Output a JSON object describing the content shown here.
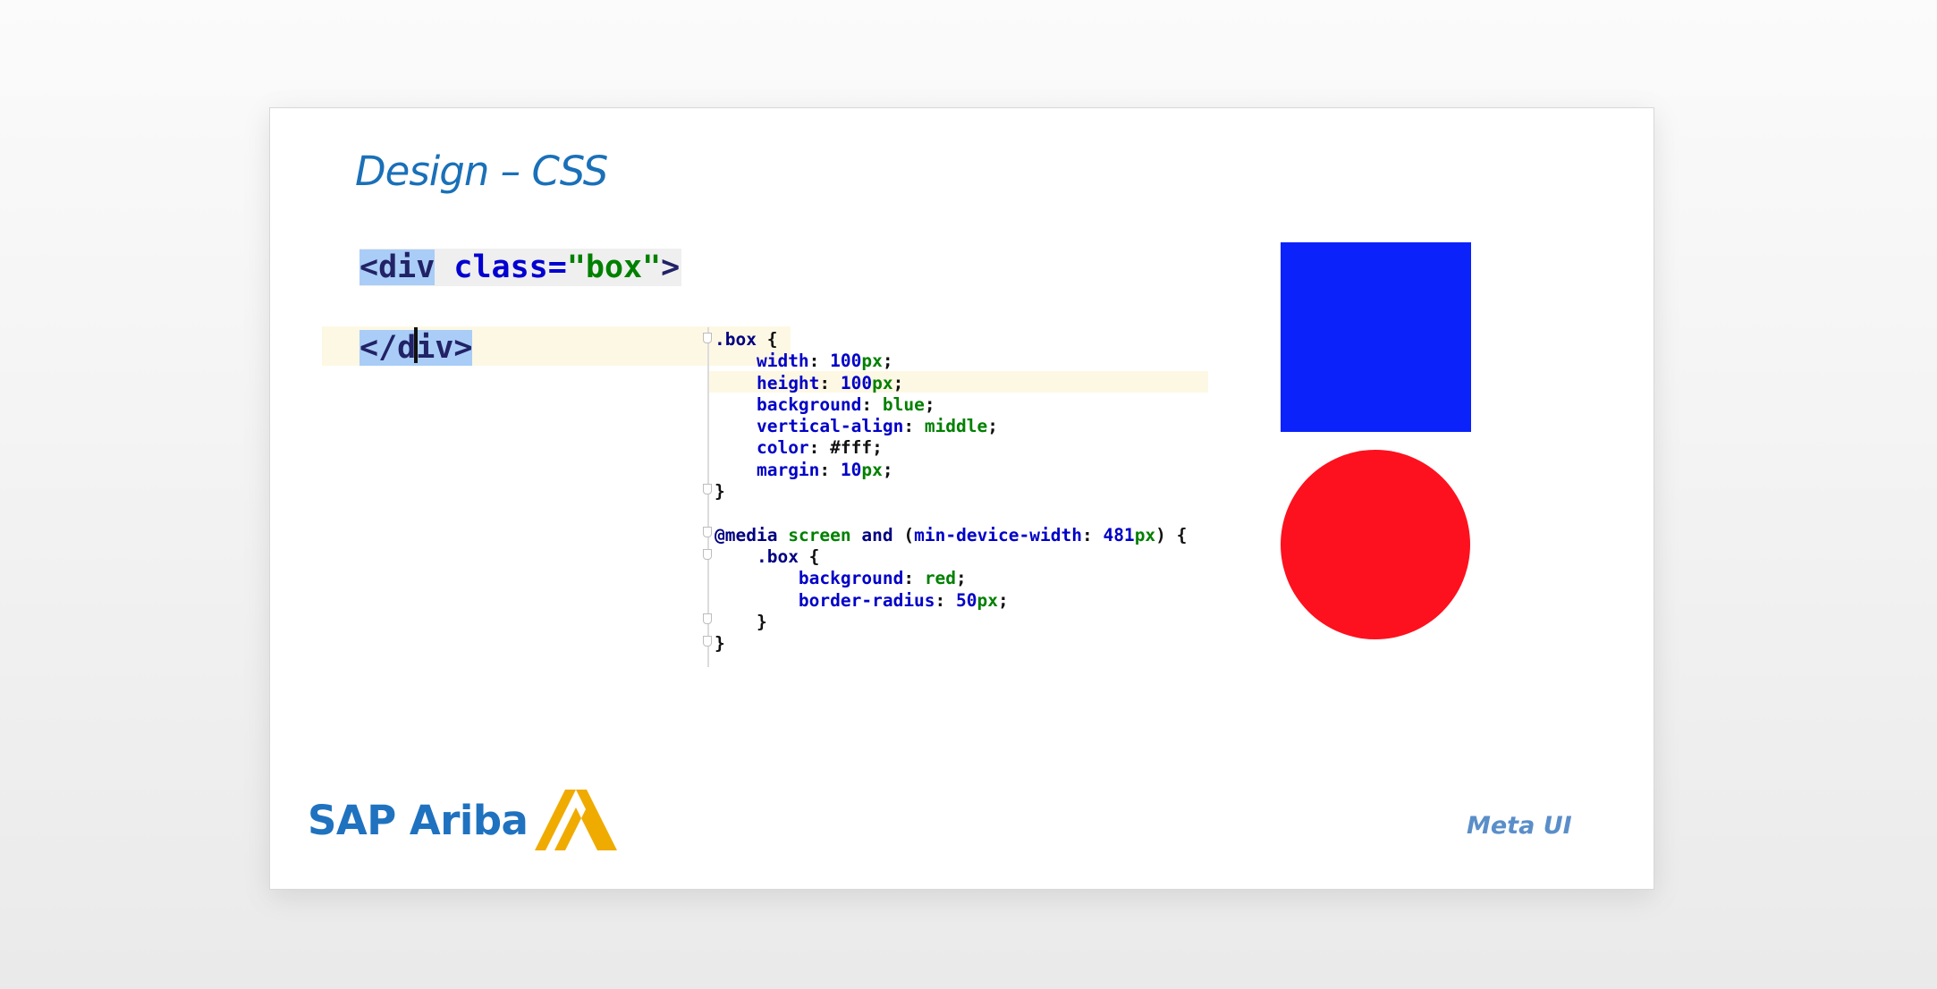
{
  "slide": {
    "title": "Design – CSS",
    "footer_note": "Meta UI",
    "logo_text": "SAP Ariba"
  },
  "html_snippet": {
    "open_tag": "<div",
    "attr_name": "class=",
    "attr_value": "\"box\"",
    "open_end": ">",
    "close_start": "</d",
    "close_end": "iv>"
  },
  "css_snippet": {
    "sel1": ".box",
    "open1": " {",
    "w_prop": "width",
    "w_num": "100",
    "w_unit": "px",
    "h_prop": "height",
    "h_num": "100",
    "h_unit": "px",
    "bg_prop": "background",
    "bg_val": "blue",
    "va_prop": "vertical-align",
    "va_val": "middle",
    "c_prop": "color",
    "c_val": "#fff",
    "m_prop": "margin",
    "m_num": "10",
    "m_unit": "px",
    "close1": "}",
    "media_kw": "@media",
    "media_screen": "screen",
    "media_and": "and",
    "media_feature": "min-device-width",
    "media_num": "481",
    "media_unit": "px",
    "sel2": ".box",
    "bg2_prop": "background",
    "bg2_val": "red",
    "br_prop": "border-radius",
    "br_num": "50",
    "br_unit": "px",
    "close2": "}",
    "close3": "}"
  },
  "colors": {
    "title": "#1a70b8",
    "box_blue": "#0b22fb",
    "circle_red": "#fd111e",
    "logo_blue": "#1f72bf",
    "logo_gold": "#f0ab00"
  }
}
